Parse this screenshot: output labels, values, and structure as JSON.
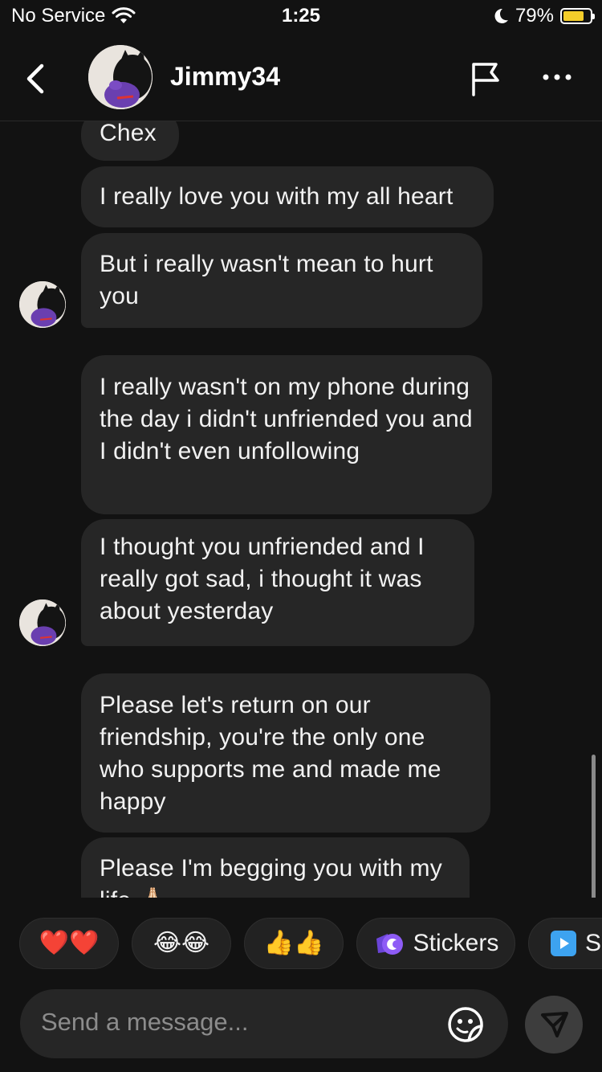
{
  "status_bar": {
    "carrier": "No Service",
    "time": "1:25",
    "battery": "79%",
    "battery_level": 0.79
  },
  "header": {
    "contact_name": "Jimmy34"
  },
  "messages": [
    {
      "text": "Chex"
    },
    {
      "text": "I really love you with my all heart"
    },
    {
      "text": "But i really wasn't mean to hurt you"
    },
    {
      "text": "I really wasn't on my phone during the day i didn't unfriended you and I didn't even unfollowing"
    },
    {
      "text": "I thought you unfriended and I really got sad, i thought it was about yesterday"
    },
    {
      "text": "Please let's return on our friendship, you're the only one who supports me and made me happy"
    },
    {
      "text": "Please I'm begging you with my life 🙏🏻"
    }
  ],
  "quick_reactions": [
    {
      "emoji": "❤️❤️"
    },
    {
      "emoji": "😂😂"
    },
    {
      "emoji": "👍👍"
    },
    {
      "label": "Stickers",
      "icon": "stickers-icon"
    },
    {
      "label": "Sl",
      "icon": "video-icon"
    }
  ],
  "composer": {
    "placeholder": "Send a message..."
  },
  "colors": {
    "background": "#121212",
    "bubble": "#262626",
    "stickers_accent": "#8e5cf6",
    "video_accent": "#3da3f0"
  }
}
